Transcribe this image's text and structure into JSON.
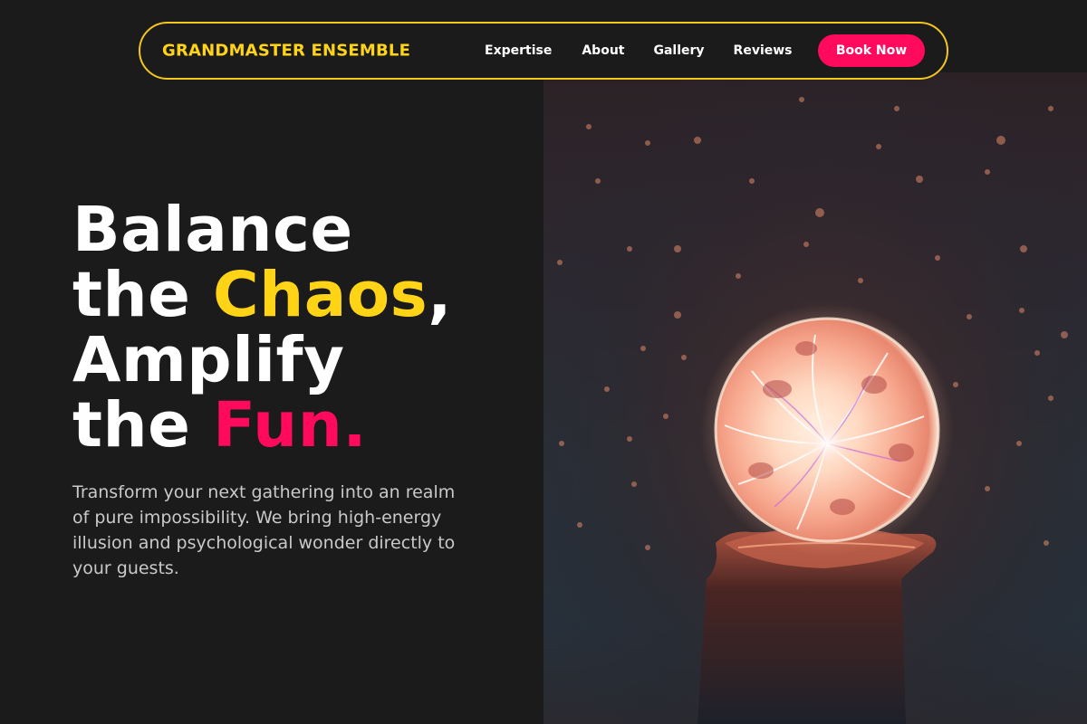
{
  "nav": {
    "brand": "GRANDMASTER ENSEMBLE",
    "links": [
      "Expertise",
      "About",
      "Gallery",
      "Reviews"
    ],
    "cta": "Book Now"
  },
  "hero": {
    "line1": "Balance",
    "line2_a": "the ",
    "line2_b": "Chaos",
    "line2_c": ",",
    "line3": "Amplify",
    "line4_a": "the ",
    "line4_b": "Fun.",
    "subtitle": "Transform your next gathering into an realm of pure impossibility. We bring high-energy illusion and psychological wonder directly to your guests."
  },
  "photo": {
    "subject": "plasma-globe-photo"
  },
  "colors": {
    "accent_yellow": "#ffd417",
    "accent_pink": "#ff0a5c",
    "background": "#1b1b1c",
    "nav_border": "#f1c71c"
  }
}
